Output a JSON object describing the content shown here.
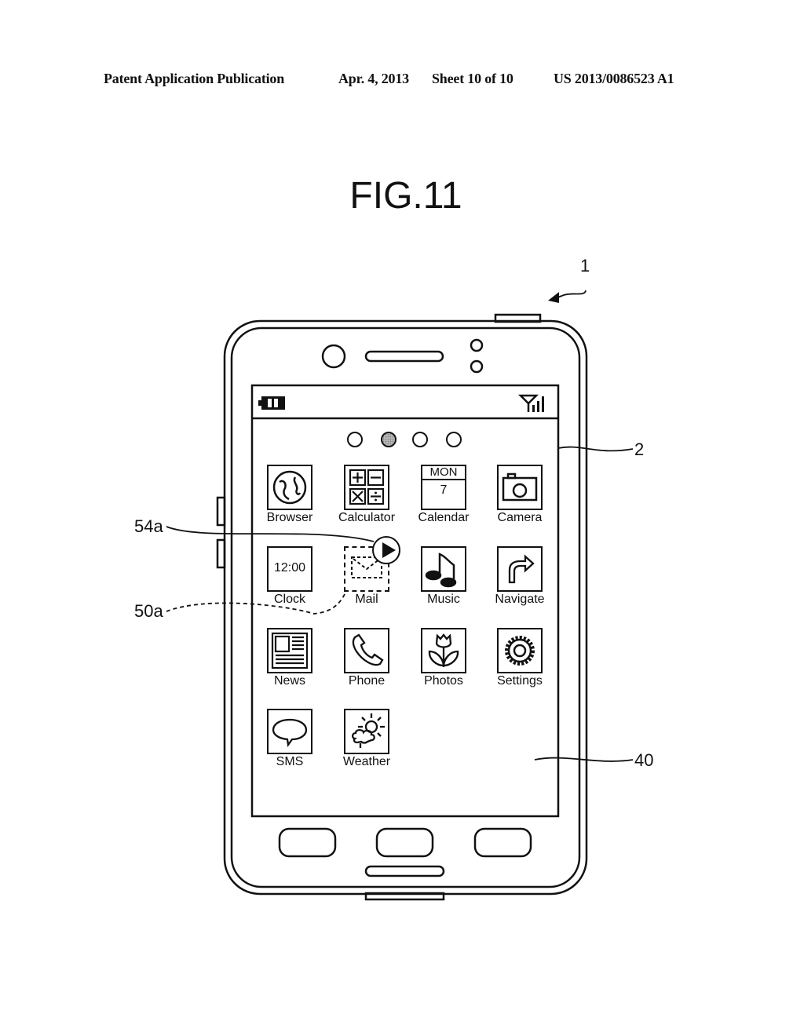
{
  "header": {
    "publication": "Patent Application Publication",
    "date": "Apr. 4, 2013",
    "sheet": "Sheet 10 of 10",
    "number": "US 2013/0086523 A1"
  },
  "figure": {
    "title": "FIG.11",
    "refs": {
      "device": "1",
      "screen": "2",
      "home_area": "40",
      "play_button": "54a",
      "dragged_icon": "50a"
    }
  },
  "phone": {
    "status_bar": {
      "battery_icon": "battery-icon",
      "signal_icon": "signal-icon"
    },
    "page_indicator": {
      "pages": 4,
      "active_page": 2
    },
    "apps": [
      {
        "label": "Browser",
        "icon": "globe-icon"
      },
      {
        "label": "Calculator",
        "icon": "calculator-icon"
      },
      {
        "label": "Calendar",
        "icon": "calendar-icon",
        "day": "MON",
        "date": "7"
      },
      {
        "label": "Camera",
        "icon": "camera-icon"
      },
      {
        "label": "Clock",
        "icon": "clock-icon",
        "time": "12:00"
      },
      {
        "label": "Mail",
        "icon": "mail-icon",
        "state": "dragging"
      },
      {
        "label": "Music",
        "icon": "music-note-icon"
      },
      {
        "label": "Navigate",
        "icon": "turn-arrow-icon"
      },
      {
        "label": "News",
        "icon": "newspaper-icon"
      },
      {
        "label": "Phone",
        "icon": "phone-handset-icon"
      },
      {
        "label": "Photos",
        "icon": "tulip-icon"
      },
      {
        "label": "Settings",
        "icon": "gear-icon"
      },
      {
        "label": "SMS",
        "icon": "speech-bubble-icon"
      },
      {
        "label": "Weather",
        "icon": "sun-cloud-icon"
      }
    ]
  }
}
